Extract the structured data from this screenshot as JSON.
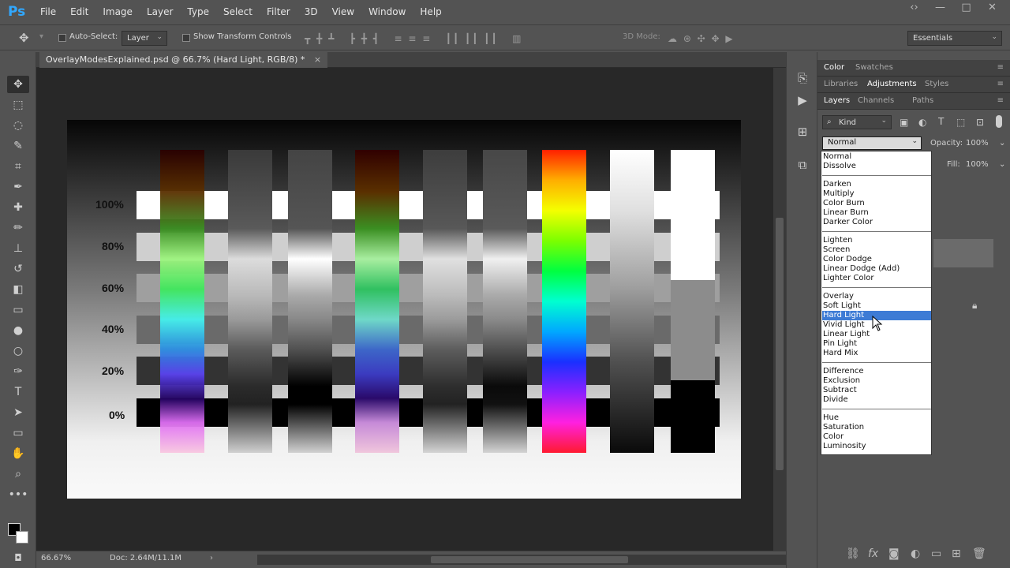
{
  "app": {
    "logo": "Ps",
    "window_controls": [
      "‹›",
      "—",
      "□",
      "✕"
    ]
  },
  "menu": [
    "File",
    "Edit",
    "Image",
    "Layer",
    "Type",
    "Select",
    "Filter",
    "3D",
    "View",
    "Window",
    "Help"
  ],
  "options": {
    "auto_select": "Auto-Select:",
    "layer_mode": "Layer",
    "show_transform": "Show Transform Controls",
    "mode_3d": "3D Mode:",
    "workspace": "Essentials"
  },
  "document": {
    "tab_title": "OverlayModesExplained.psd @ 66.7% (Hard Light, RGB/8) *",
    "close": "×",
    "percent_labels": [
      "100%",
      "80%",
      "60%",
      "40%",
      "20%",
      "0%"
    ]
  },
  "status": {
    "zoom": "66.67%",
    "doc_size": "Doc: 2.64M/11.1M",
    "arrow": "›"
  },
  "panels": {
    "row1": [
      "Color",
      "Swatches"
    ],
    "row2": [
      "Libraries",
      "Adjustments",
      "Styles"
    ],
    "row3": [
      "Layers",
      "Channels",
      "Paths"
    ],
    "kind": "Kind",
    "blend_mode": "Normal",
    "opacity_label": "Opacity:",
    "opacity_value": "100%",
    "fill_label": "Fill:",
    "fill_value": "100%"
  },
  "blend_groups": [
    [
      "Normal",
      "Dissolve"
    ],
    [
      "Darken",
      "Multiply",
      "Color Burn",
      "Linear Burn",
      "Darker Color"
    ],
    [
      "Lighten",
      "Screen",
      "Color Dodge",
      "Linear Dodge (Add)",
      "Lighter Color"
    ],
    [
      "Overlay",
      "Soft Light",
      "Hard Light",
      "Vivid Light",
      "Linear Light",
      "Pin Light",
      "Hard Mix"
    ],
    [
      "Difference",
      "Exclusion",
      "Subtract",
      "Divide"
    ],
    [
      "Hue",
      "Saturation",
      "Color",
      "Luminosity"
    ]
  ],
  "selected_blend": "Hard Light",
  "colors": {
    "selection": "#3d7bd5",
    "accent": "#31a8ff"
  }
}
